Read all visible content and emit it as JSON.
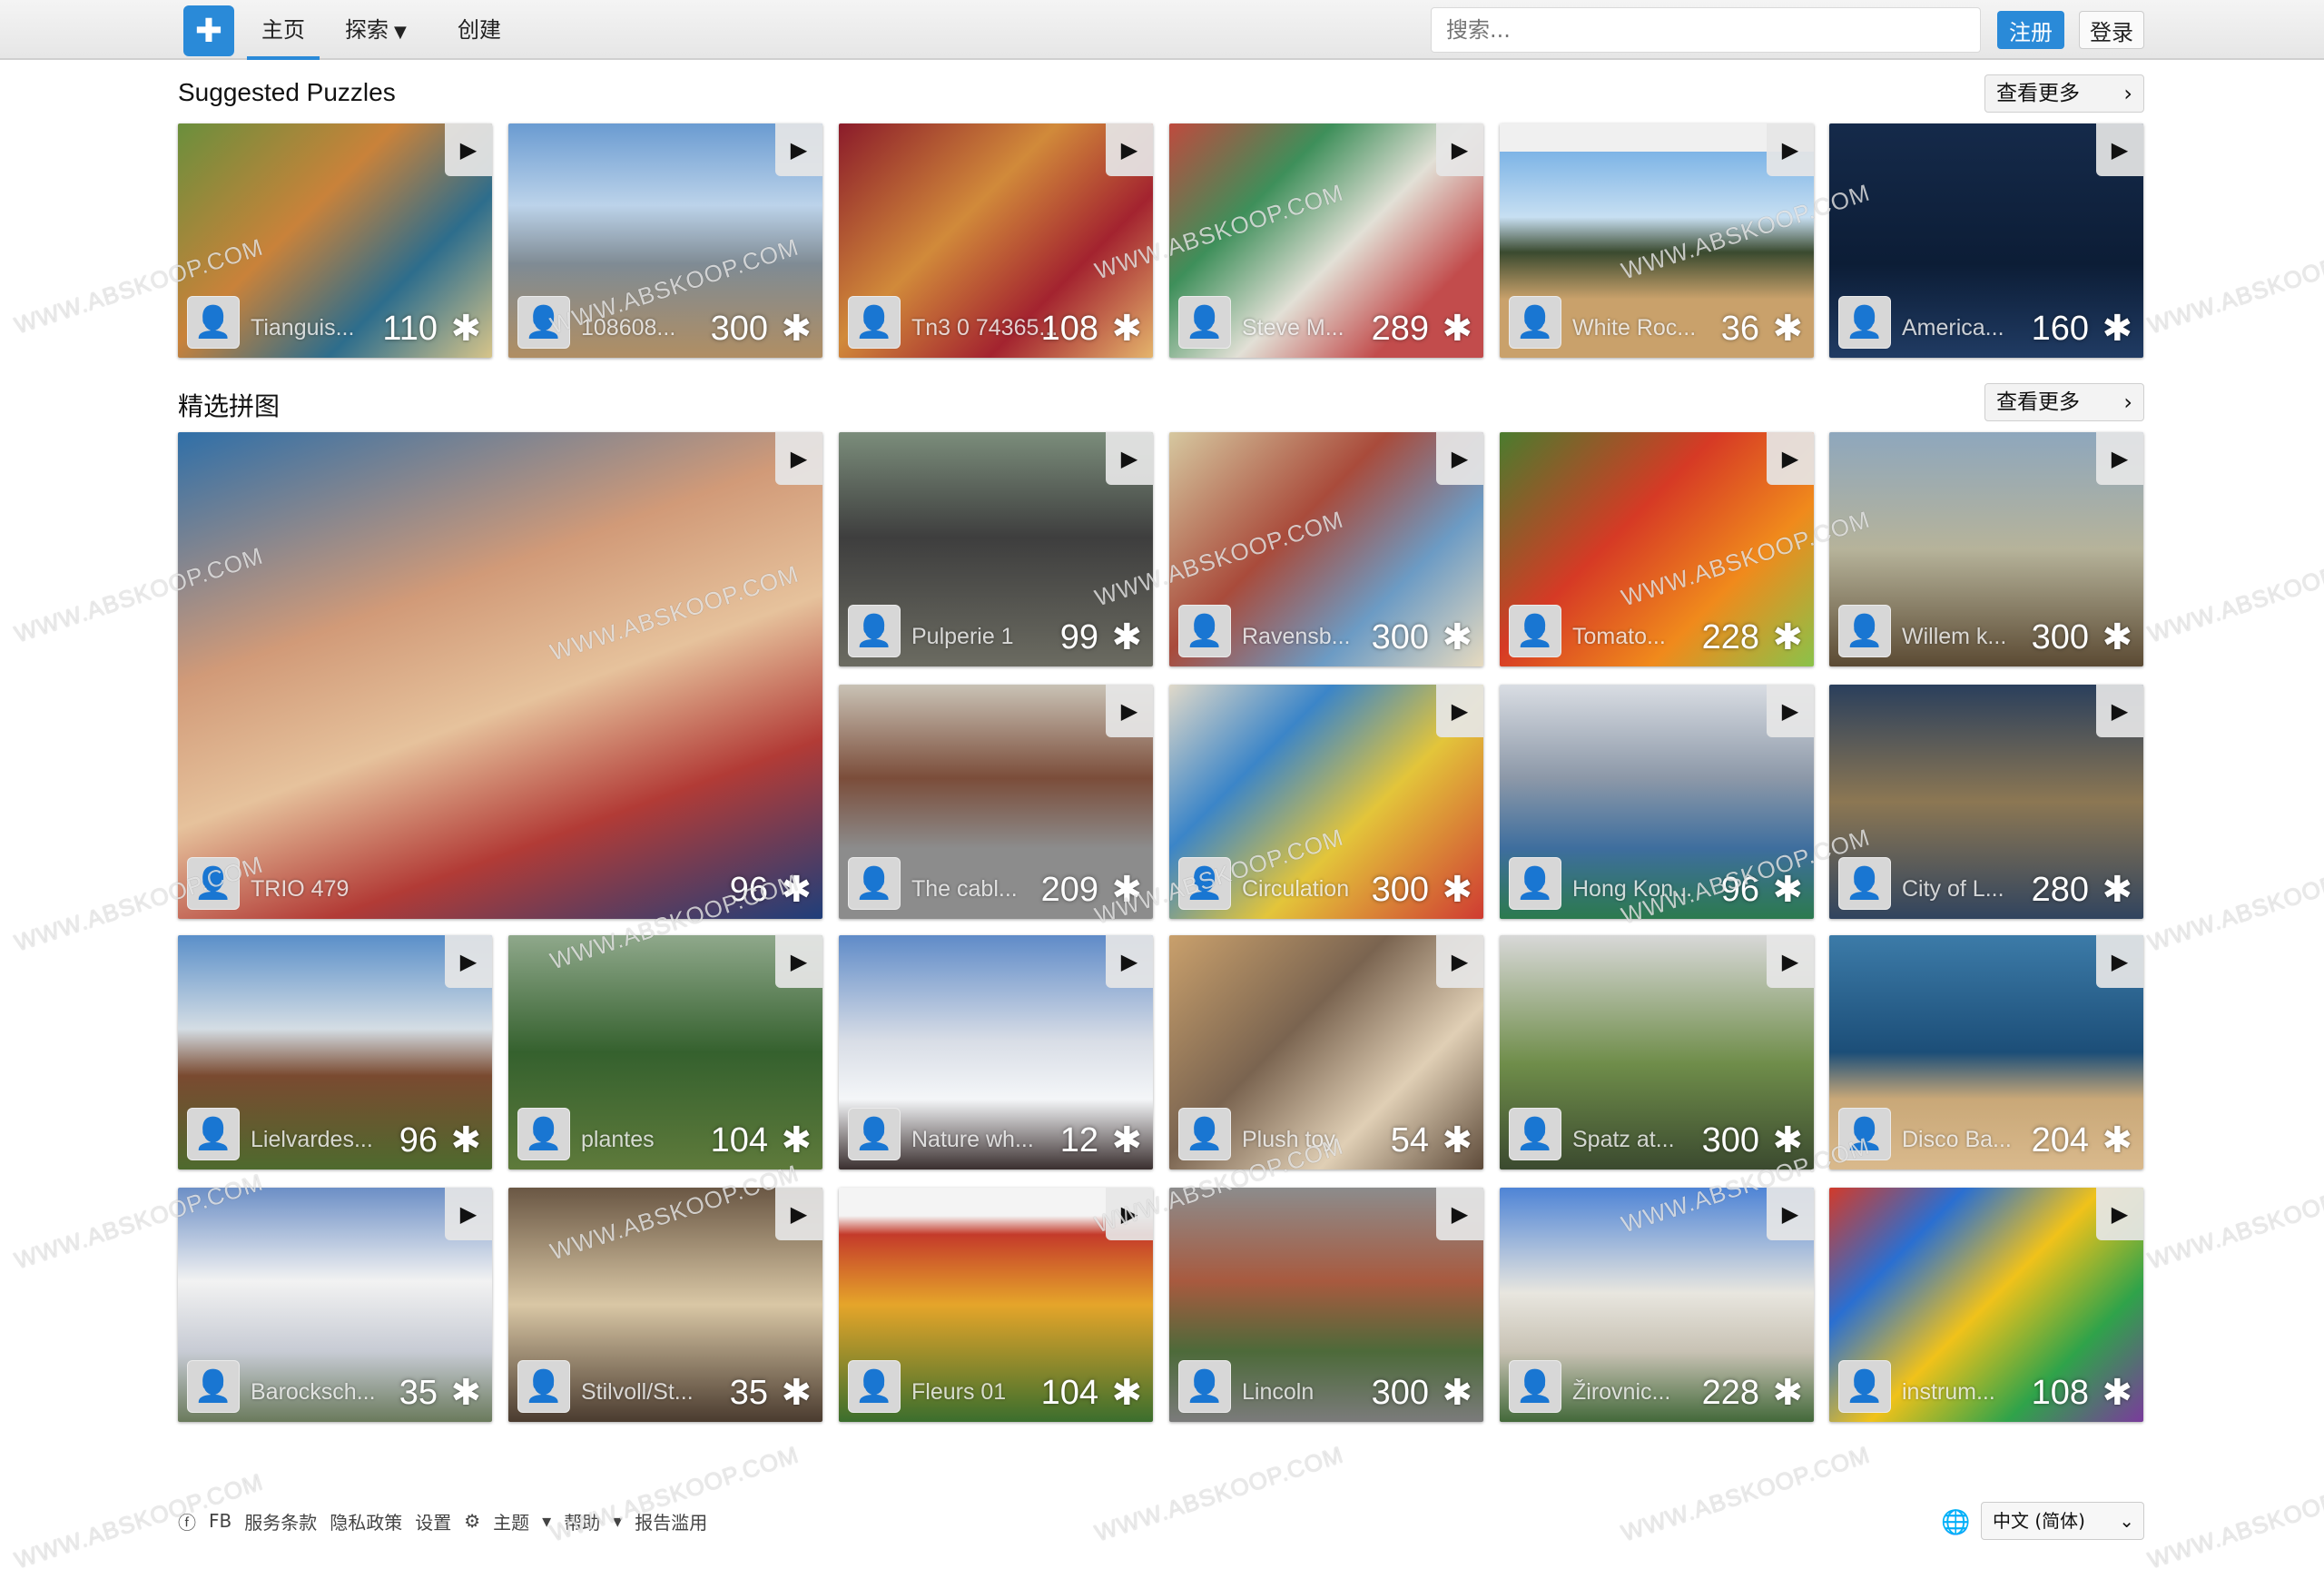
{
  "nav": {
    "home": "主页",
    "explore": "探索",
    "create": "创建",
    "search_placeholder": "搜索...",
    "register": "注册",
    "login": "登录"
  },
  "suggested": {
    "title": "Suggested Puzzles",
    "see_more": "查看更多",
    "items": [
      {
        "name": "Tianguis...",
        "count": "110"
      },
      {
        "name": "108608...",
        "count": "300"
      },
      {
        "name": "Tn3 0 74365...",
        "count": "108"
      },
      {
        "name": "Steve M...",
        "count": "289"
      },
      {
        "name": "White Roc...",
        "count": "36"
      },
      {
        "name": "America...",
        "count": "160"
      }
    ]
  },
  "featured": {
    "title": "精选拼图",
    "see_more": "查看更多",
    "items": [
      {
        "name": "TRIO 479",
        "count": "96"
      },
      {
        "name": "Pulperie 1",
        "count": "99"
      },
      {
        "name": "Ravensb...",
        "count": "300"
      },
      {
        "name": "Tomato...",
        "count": "228"
      },
      {
        "name": "Willem k...",
        "count": "300"
      },
      {
        "name": "The cabl...",
        "count": "209"
      },
      {
        "name": "Circulation",
        "count": "300"
      },
      {
        "name": "Hong Kon...",
        "count": "96"
      },
      {
        "name": "City of L...",
        "count": "280"
      },
      {
        "name": "Lielvardes...",
        "count": "96"
      },
      {
        "name": "plantes",
        "count": "104"
      },
      {
        "name": "Nature wh...",
        "count": "12"
      },
      {
        "name": "Plush toy",
        "count": "54"
      },
      {
        "name": "Spatz at...",
        "count": "300"
      },
      {
        "name": "Disco Ba...",
        "count": "204"
      },
      {
        "name": "Barocksch...",
        "count": "35"
      },
      {
        "name": "Stilvoll/St...",
        "count": "35"
      },
      {
        "name": "Fleurs 01",
        "count": "104"
      },
      {
        "name": "Lincoln",
        "count": "300"
      },
      {
        "name": "Žirovnic...",
        "count": "228"
      },
      {
        "name": "instrum...",
        "count": "108"
      }
    ]
  },
  "footer": {
    "fb": "FB",
    "terms": "服务条款",
    "privacy": "隐私政策",
    "settings": "设置",
    "theme": "主题",
    "help": "帮助",
    "report": "报告滥用",
    "language": "中文 (简体)"
  },
  "watermark": "WWW.ABSKOOP.COM",
  "colors": {
    "accent": "#2a8ad8",
    "topbar": "#ececec"
  }
}
